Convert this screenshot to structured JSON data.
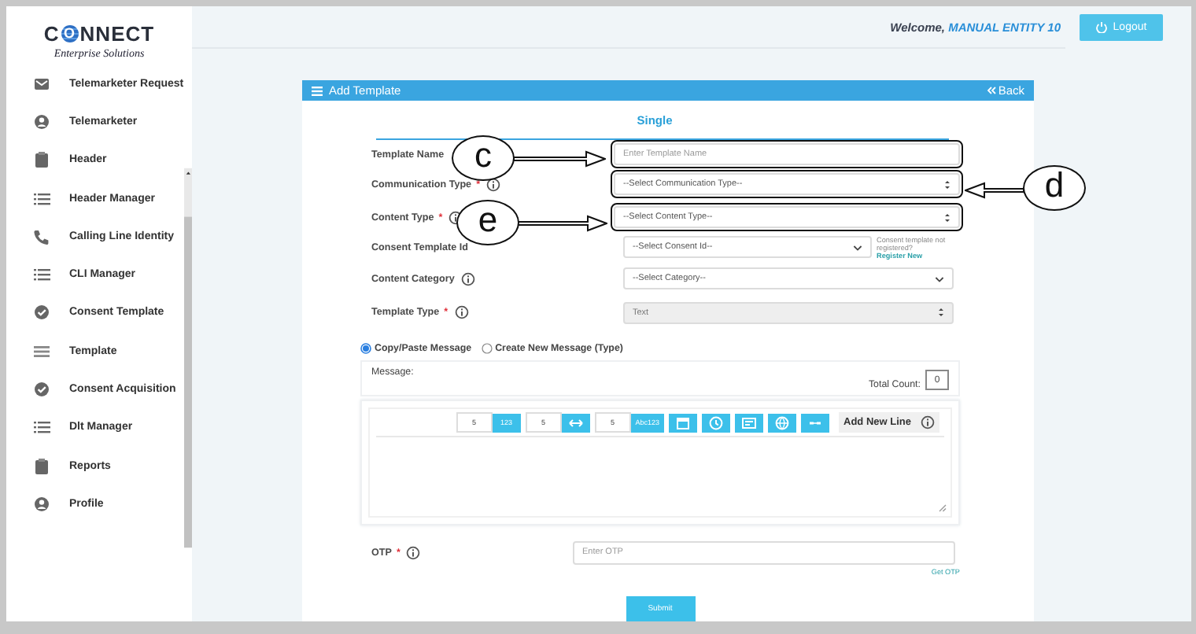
{
  "logo": {
    "name": "CONNECT",
    "tagline": "Enterprise Solutions"
  },
  "sidebar": {
    "items": [
      {
        "label": "Telemarketer Request"
      },
      {
        "label": "Telemarketer"
      },
      {
        "label": "Header"
      },
      {
        "label": "Header Manager"
      },
      {
        "label": "Calling Line Identity"
      },
      {
        "label": "CLI Manager"
      },
      {
        "label": "Consent Template"
      },
      {
        "label": "Template"
      },
      {
        "label": "Consent Acquisition"
      },
      {
        "label": "Dlt Manager"
      },
      {
        "label": "Reports"
      },
      {
        "label": "Profile"
      }
    ]
  },
  "header": {
    "welcome": "Welcome,",
    "user": "MANUAL ENTITY 10",
    "logout": "Logout"
  },
  "card": {
    "title": "Add Template",
    "back": "Back",
    "tabs": [
      {
        "label": "Single",
        "selected": true
      }
    ],
    "fields": [
      {
        "label": "Template Name",
        "info": false,
        "highlighted": true,
        "kind": "text-input",
        "placeholder": "Enter Template Name"
      },
      {
        "label": "Communication Type",
        "required_mark": "*",
        "info": true,
        "highlighted": true,
        "kind": "spinner-select",
        "value": "--Select Communication Type--"
      },
      {
        "label": "Content Type",
        "required_mark": "*",
        "info": true,
        "highlighted": true,
        "kind": "spinner-select",
        "value": "--Select Content Type--"
      },
      {
        "label": "Consent Template Id",
        "info": false,
        "highlighted": false,
        "kind": "dropdown",
        "value": "--Select Consent Id--",
        "note": "Consent template not registered?",
        "link": "Register New"
      },
      {
        "label": "Content Category",
        "info": true,
        "highlighted": false,
        "kind": "dropdown",
        "value": "--Select Category--"
      },
      {
        "label": "Template Type",
        "required_mark": "*",
        "info": true,
        "highlighted": false,
        "kind": "spinner-select",
        "value": "Text",
        "disabled": true
      }
    ],
    "message_modes": [
      {
        "label": "Copy/Paste Message",
        "selected": true
      },
      {
        "label": "Create New Message (Type)",
        "selected": false
      }
    ],
    "message": {
      "label": "Message:",
      "total_count_label": "Total Count:",
      "total_count": "0"
    },
    "toolbar": [
      {
        "kind": "number-input",
        "value": "5"
      },
      {
        "kind": "text-button",
        "text": "123"
      },
      {
        "kind": "number-input",
        "value": "5"
      },
      {
        "kind": "icon-button"
      },
      {
        "kind": "number-input",
        "value": "5"
      },
      {
        "kind": "text-button",
        "text": "Abc123"
      },
      {
        "kind": "icon-button"
      },
      {
        "kind": "icon-button"
      },
      {
        "kind": "icon-button"
      },
      {
        "kind": "icon-button"
      },
      {
        "kind": "icon-button"
      }
    ],
    "add_new_line": "Add New Line",
    "otp": {
      "label": "OTP",
      "required_mark": "*",
      "info": true,
      "placeholder": "Enter OTP",
      "link": "Get OTP"
    },
    "submit": "Submit"
  },
  "annotations": [
    {
      "label": "c"
    },
    {
      "label": "d"
    },
    {
      "label": "e"
    }
  ]
}
